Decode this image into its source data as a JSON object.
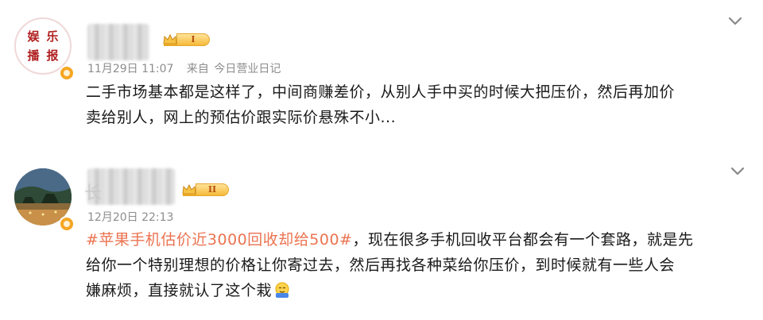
{
  "posts": [
    {
      "avatar_text": [
        "娱",
        "乐",
        "播",
        "报"
      ],
      "level_badge": "I",
      "date": "11月29日",
      "time": "11:07",
      "source_label": "来自",
      "source_name": "今日营业日记",
      "body_lines": [
        "二手市场基本都是这样了，中间商赚差价，从别人手中买的时候大把压价，然后再加价",
        "卖给别人，网上的预估价跟实际价悬殊不小..."
      ]
    },
    {
      "name_prefix": "长",
      "level_badge": "II",
      "date": "12月20日",
      "time": "22:13",
      "hashtag": "#苹果手机估价近3000回收却给500#",
      "body_first_rest": "，现在很多手机回收平台都会有一个套路，就是先",
      "body_lines": [
        "给你一个特别理想的价格让你寄过去，然后再找各种菜给你压价，到时候就有一些人会",
        "嫌麻烦，直接就认了这个栽"
      ]
    }
  ],
  "icons": {
    "chevron": "chevron-down-icon",
    "verified": "verified-badge-icon",
    "crown": "crown-icon",
    "emoji": "facepalm-emoji-icon"
  },
  "colors": {
    "hashtag": "#eb7350",
    "meta": "#8d8d8d",
    "badge": "#f5b93a"
  }
}
